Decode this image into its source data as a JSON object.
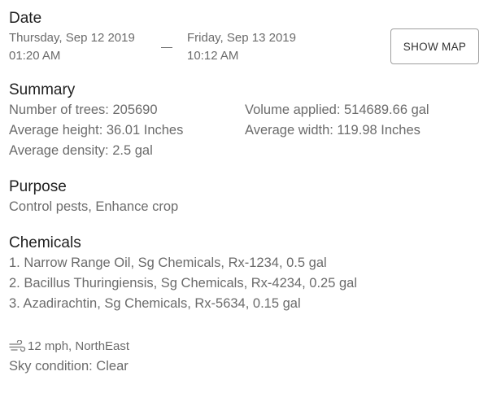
{
  "date": {
    "title": "Date",
    "start_date": "Thursday, Sep 12 2019",
    "start_time": "01:20 AM",
    "end_date": "Friday, Sep 13 2019",
    "end_time": "10:12 AM",
    "show_map_label": "SHOW MAP"
  },
  "summary": {
    "title": "Summary",
    "trees": "Number of trees: 205690",
    "volume": "Volume applied: 514689.66 gal",
    "height": "Average height: 36.01 Inches",
    "width": "Average width: 119.98 Inches",
    "density": "Average density: 2.5 gal"
  },
  "purpose": {
    "title": "Purpose",
    "value": "Control pests, Enhance crop"
  },
  "chemicals": {
    "title": "Chemicals",
    "items": [
      "1. Narrow Range Oil, Sg Chemicals, Rx-1234, 0.5 gal",
      "2. Bacillus Thuringiensis, Sg Chemicals, Rx-4234, 0.25 gal",
      "3. Azadirachtin, Sg Chemicals, Rx-5634, 0.15 gal"
    ]
  },
  "weather": {
    "wind_icon": "wind-icon",
    "wind": "12 mph, NorthEast",
    "sky": "Sky condition: Clear"
  },
  "colors": {
    "heading": "#212121",
    "body_text": "#6b6b6b",
    "button_border": "#9e9e9e"
  }
}
